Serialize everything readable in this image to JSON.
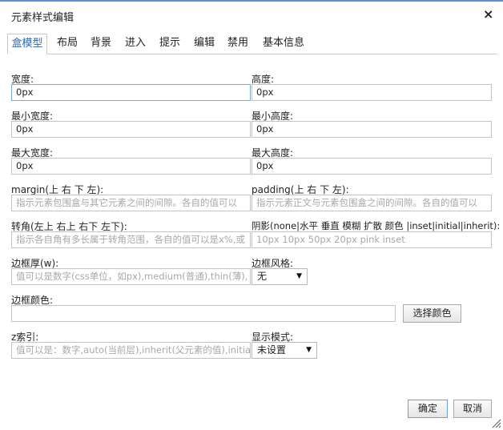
{
  "dialog": {
    "title": "元素样式编辑",
    "close_symbol": "×"
  },
  "tabs": [
    {
      "label": "盒模型"
    },
    {
      "label": "布局"
    },
    {
      "label": "背景"
    },
    {
      "label": "进入"
    },
    {
      "label": "提示"
    },
    {
      "label": "编辑"
    },
    {
      "label": "禁用"
    },
    {
      "label": "基本信息"
    }
  ],
  "form": {
    "width": {
      "label": "宽度:",
      "value": "0px"
    },
    "height": {
      "label": "高度:",
      "value": "0px"
    },
    "min_width": {
      "label": "最小宽度:",
      "value": "0px"
    },
    "min_height": {
      "label": "最小高度:",
      "value": "0px"
    },
    "max_width": {
      "label": "最大宽度:",
      "value": "0px"
    },
    "max_height": {
      "label": "最大高度:",
      "value": "0px"
    },
    "margin": {
      "label": "margin(上 右 下 左):",
      "placeholder": "指示元素包围盒与其它元素之间的间隙。各自的值可以"
    },
    "padding": {
      "label": "padding(上 右 下 左):",
      "placeholder": "指示元素正文与元素包围盒之间的间隙。各自的值可以"
    },
    "border_radius": {
      "label": "转角(左上 右上 右下 左下):",
      "placeholder": "指示各自角有多长属于转角范围，各自的值可以是x%,或"
    },
    "box_shadow": {
      "label": "阴影(none|水平 垂直 模糊 扩散 颜色 |inset|initial|inherit):",
      "placeholder": "10px 10px 50px 20px pink inset"
    },
    "border_width": {
      "label": "边框厚(w):",
      "placeholder": "值可以是数字(css单位，如px),medium(普通),thin(薄),"
    },
    "border_style": {
      "label": "边框风格:",
      "selected": "无"
    },
    "border_color": {
      "label": "边框颜色:",
      "value": "",
      "button": "选择颜色"
    },
    "z_index": {
      "label": "z索引:",
      "placeholder": "值可以是：数字,auto(当前层),inherit(父元素的值),initia"
    },
    "display": {
      "label": "显示模式:",
      "selected": "未设置"
    }
  },
  "footer": {
    "ok": "确定",
    "cancel": "取消"
  },
  "icons": {
    "dropdown": "▼",
    "resize": "resize-grip-icon"
  },
  "colors": {
    "accent": "#2b6cb0",
    "top_line": "#5b8fd6",
    "placeholder": "#a8a8a8"
  }
}
